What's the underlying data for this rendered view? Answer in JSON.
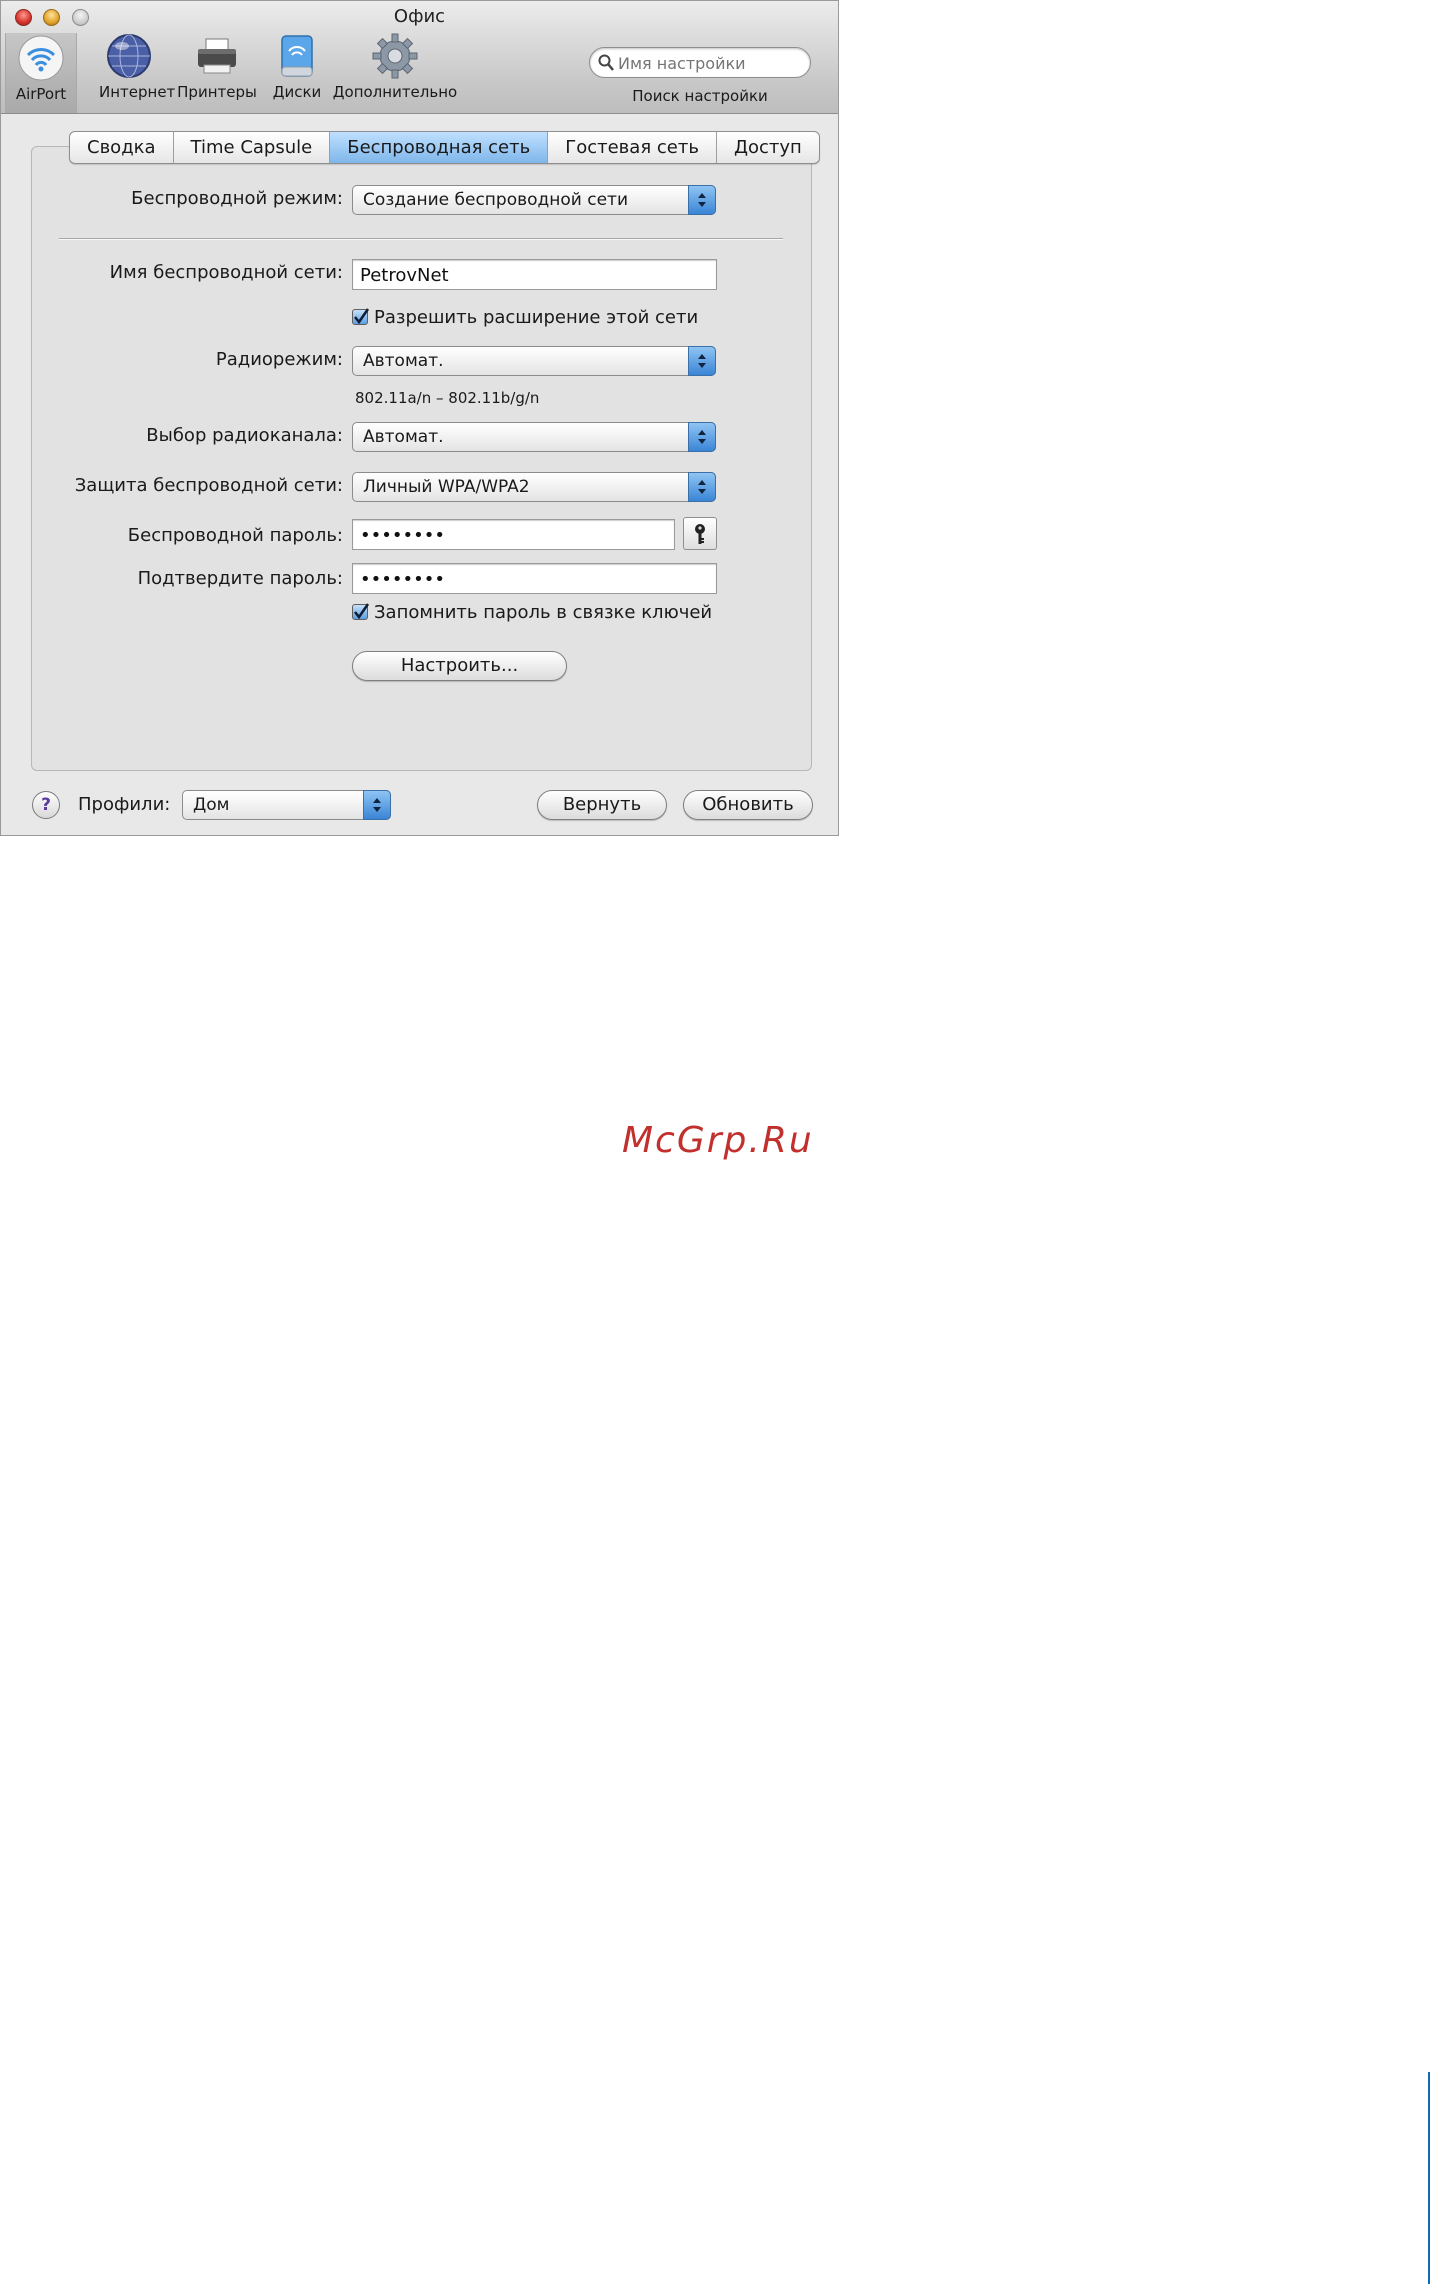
{
  "window": {
    "title": "Офис",
    "toolbar": [
      {
        "id": "airport",
        "label": "AirPort",
        "icon": "wifi-icon"
      },
      {
        "id": "internet",
        "label": "Интернет",
        "icon": "globe-icon"
      },
      {
        "id": "printers",
        "label": "Принтеры",
        "icon": "printer-icon"
      },
      {
        "id": "disks",
        "label": "Диски",
        "icon": "disk-icon"
      },
      {
        "id": "advanced",
        "label": "Дополнительно",
        "icon": "gear-icon"
      }
    ],
    "search": {
      "placeholder": "Имя настройки",
      "caption": "Поиск настройки"
    }
  },
  "tabs": [
    {
      "label": "Сводка",
      "active": false
    },
    {
      "label": "Time Capsule",
      "active": false
    },
    {
      "label": "Беспроводная сеть",
      "active": true
    },
    {
      "label": "Гостевая сеть",
      "active": false
    },
    {
      "label": "Доступ",
      "active": false
    }
  ],
  "form": {
    "wireless_mode": {
      "label": "Беспроводной режим:",
      "value": "Создание беспроводной сети"
    },
    "network_name": {
      "label": "Имя беспроводной сети:",
      "value": "PetrovNet"
    },
    "allow_extend": {
      "label": "Разрешить расширение этой сети",
      "checked": true
    },
    "radio_mode": {
      "label": "Радиорежим:",
      "value": "Автомат.",
      "note": "802.11a/n – 802.11b/g/n"
    },
    "radio_channel": {
      "label": "Выбор радиоканала:",
      "value": "Автомат."
    },
    "security": {
      "label": "Защита беспроводной сети:",
      "value": "Личный WPA/WPA2"
    },
    "password": {
      "label": "Беспроводной пароль:",
      "value": "••••••••"
    },
    "confirm_password": {
      "label": "Подтвердите пароль:",
      "value": "••••••••"
    },
    "remember_keychain": {
      "label": "Запомнить пароль в связке ключей",
      "checked": true
    },
    "configure_button": "Настроить..."
  },
  "footer": {
    "help": "?",
    "profiles_label": "Профили:",
    "profile_value": "Дом",
    "revert_button": "Вернуть",
    "update_button": "Обновить"
  },
  "watermark": "McGrp.Ru",
  "colors": {
    "tab_active": "#8fc1ee",
    "popup_arrow": "#3a85d6",
    "watermark": "#c2302d",
    "page_bar": "#0f6bb3"
  }
}
